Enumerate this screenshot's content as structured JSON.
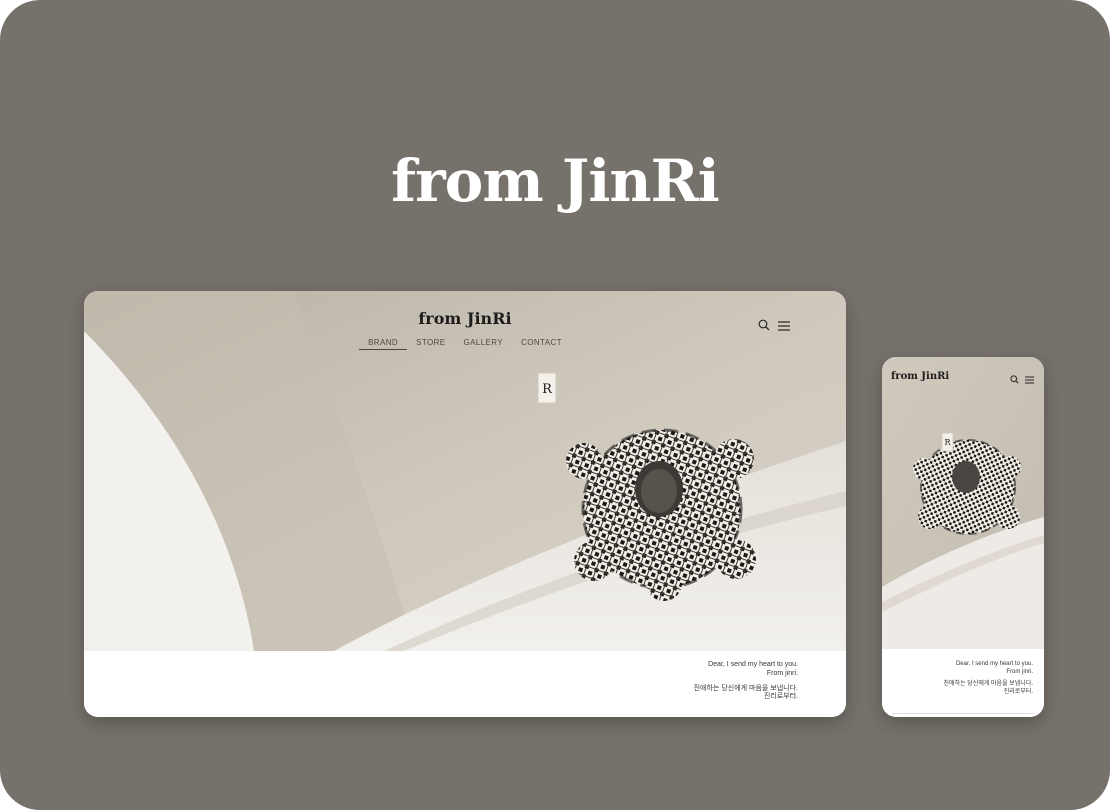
{
  "hero": {
    "title": "from JinRi"
  },
  "desktop": {
    "logo": "from JinRi",
    "nav": [
      "BRAND",
      "STORE",
      "GALLERY",
      "CONTACT"
    ],
    "icons": [
      "search-icon",
      "menu-icon"
    ],
    "message": {
      "en_line1": "Dear, I send my heart to you.",
      "en_line2": "From jinri.",
      "ko_line1": "진애하는 당신에게 마음을 보냅니다.",
      "ko_line2": "진리로부터."
    }
  },
  "mobile": {
    "logo": "from JinRi",
    "icons": [
      "search-icon",
      "menu-icon"
    ],
    "message": {
      "en_line1": "Dear, I send my heart to you.",
      "en_line2": "From jinri.",
      "ko_line1": "친애하는 당신에게 마음을 보냅니다.",
      "ko_line2": "진리로부터."
    }
  },
  "photo": {
    "tag_letter": "R"
  },
  "colors": {
    "background": "#76716b",
    "photo_base": "#d3ccc1",
    "scrunchie": "#1c1a18",
    "text_dark": "#1e1c1a"
  }
}
